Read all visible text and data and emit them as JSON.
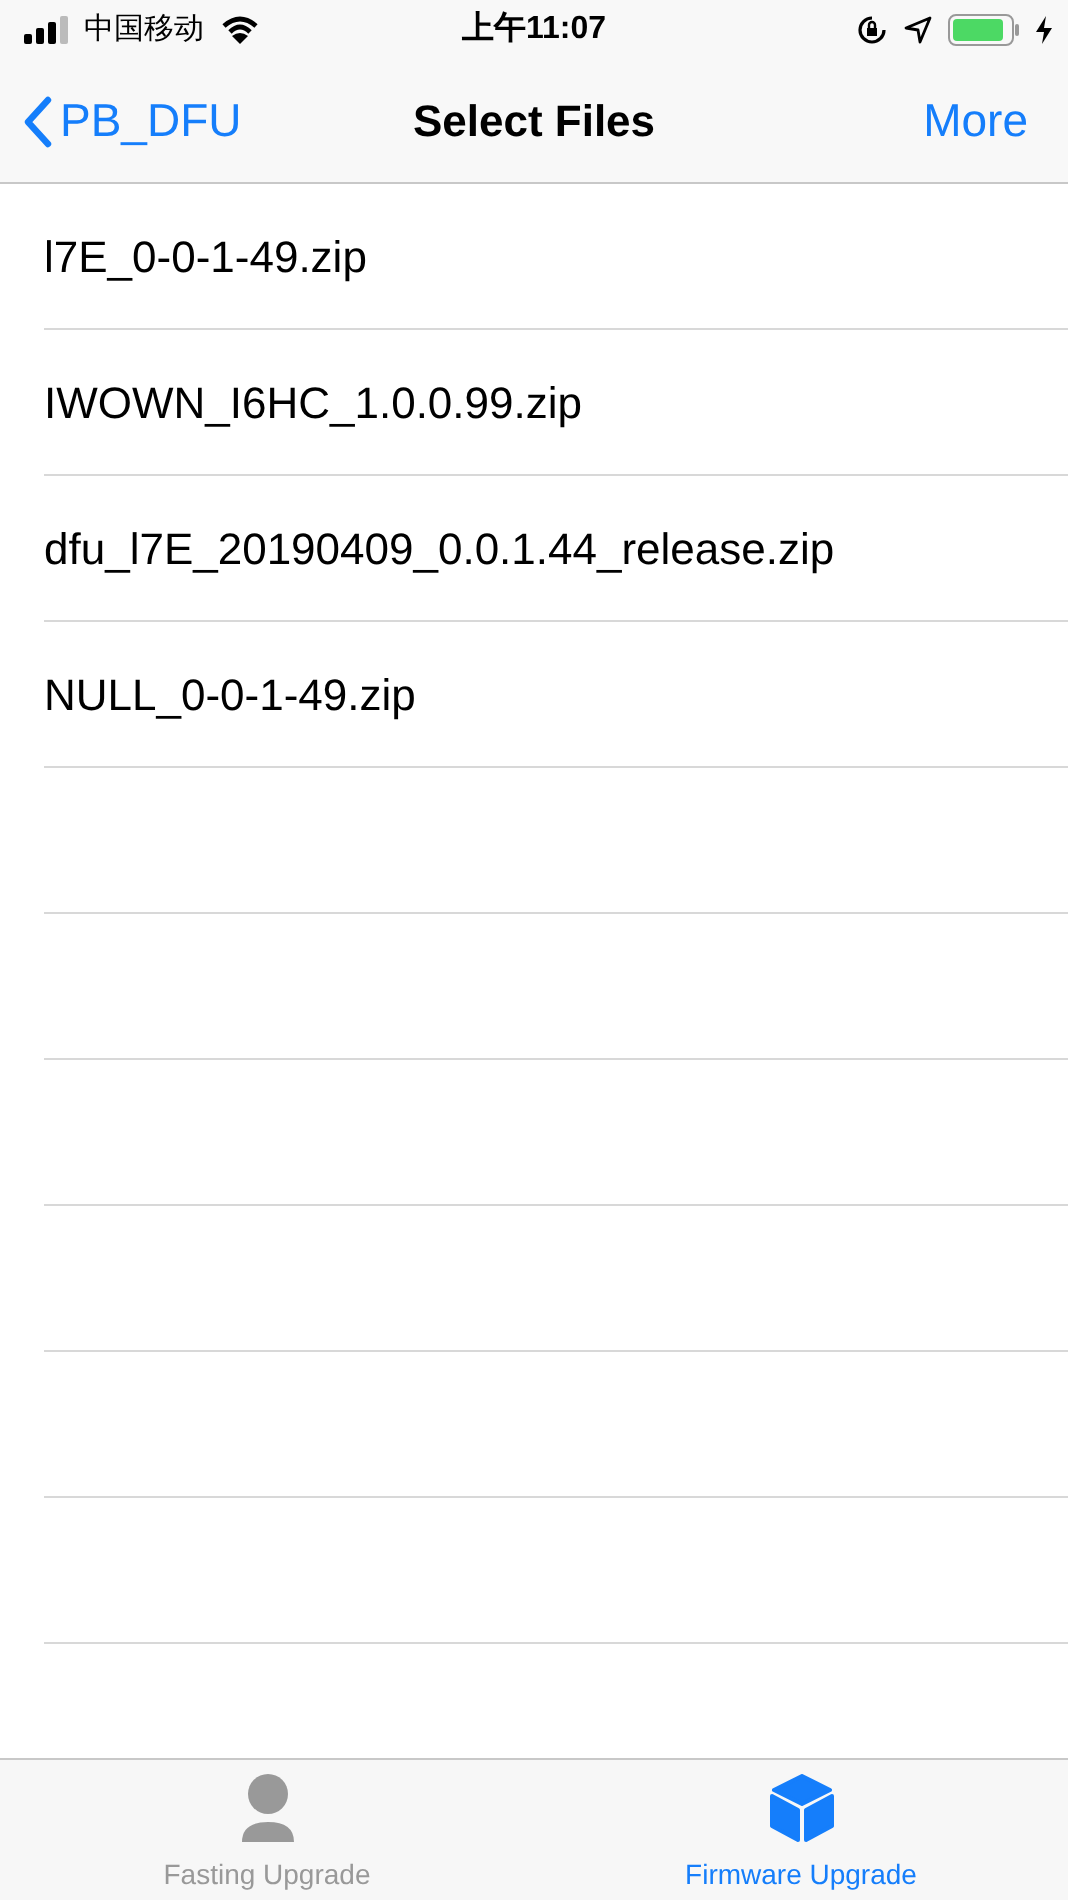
{
  "status_bar": {
    "carrier": "中国移动",
    "time": "上午11:07"
  },
  "nav_bar": {
    "back": "PB_DFU",
    "title": "Select Files",
    "action": "More"
  },
  "files": [
    "l7E_0-0-1-49.zip",
    "IWOWN_I6HC_1.0.0.99.zip",
    "dfu_l7E_20190409_0.0.1.44_release.zip",
    "NULL_0-0-1-49.zip"
  ],
  "tab_bar": [
    {
      "label": "Fasting Upgrade",
      "kind": "person",
      "selected": false
    },
    {
      "label": "Firmware Upgrade",
      "kind": "cube",
      "selected": true
    }
  ]
}
